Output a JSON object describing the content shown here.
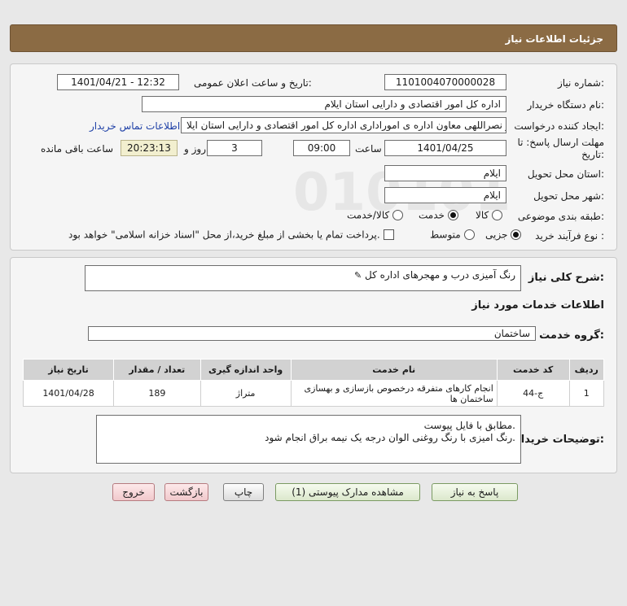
{
  "header": {
    "title": "جزئیات اطلاعات نیاز"
  },
  "form": {
    "need_number_label": "شماره نیاز:",
    "need_number": "1101004070000028",
    "announce_label": "تاریخ و ساعت اعلان عمومی:",
    "announce_value": "1401/04/21 - 12:32",
    "buyer_org_label": "نام دستگاه خریدار:",
    "buyer_org": "اداره کل امور اقتصادی و دارایی استان ایلام",
    "creator_label": "ایجاد کننده درخواست:",
    "creator": "امیر نصراللهی معاون اداره ی اموراداری اداره کل امور اقتصادی و دارایی استان ایلا",
    "contact_link": "اطلاعات تماس خریدار",
    "deadline_label": "مهلت ارسال پاسخ: تا تاریخ:",
    "deadline_date": "1401/04/25",
    "time_label": "ساعت",
    "deadline_time": "09:00",
    "days_value": "3",
    "days_label": "روز و",
    "remaining_time": "20:23:13",
    "remaining_label": "ساعت باقی مانده",
    "province_label": "استان محل تحویل:",
    "province": "ایلام",
    "city_label": "شهر محل تحویل:",
    "city": "ایلام",
    "category_label": "طبقه بندی موضوعی:",
    "category_options": [
      "کالا",
      "خدمت",
      "کالا/خدمت"
    ],
    "category_selected": 1,
    "process_label": "نوع فرآیند خرید :",
    "process_options": [
      "جزیی",
      "متوسط"
    ],
    "process_selected": 0,
    "payment_note": "پرداخت تمام یا بخشی از مبلغ خرید،از محل \"اسناد خزانه اسلامی\" خواهد بود."
  },
  "summary": {
    "label": "شرح کلی نیاز:",
    "value": "رنگ آمیزی درب و مهجرهای اداره کل",
    "services_title": "اطلاعات خدمات مورد نیاز",
    "service_group_label": "گروه خدمت:",
    "service_group": "ساختمان"
  },
  "table": {
    "headers": [
      "ردیف",
      "کد خدمت",
      "نام خدمت",
      "واحد اندازه گیری",
      "تعداد / مقدار",
      "تاریخ نیاز"
    ],
    "rows": [
      [
        "1",
        "ج-44",
        "انجام کارهای متفرقه درخصوص بازسازی و بهسازی ساختمان ها",
        "متراژ",
        "189",
        "1401/04/28"
      ]
    ]
  },
  "buyer_notes": {
    "label": "توضیحات خریدار:",
    "line1": "مطابق با فایل پیوست.",
    "line2": "رنگ امیزی با رنگ روغنی الوان درجه یک نیمه براق انجام شود."
  },
  "buttons": {
    "reply": "پاسخ به نیاز",
    "attachments": "مشاهده مدارک پیوستی (1)",
    "print": "چاپ",
    "back": "بازگشت",
    "exit": "خروج"
  },
  "colors": {
    "header_bg": "#8b6b44",
    "link": "#1d3fa6",
    "timer_bg": "#f2efcf"
  }
}
